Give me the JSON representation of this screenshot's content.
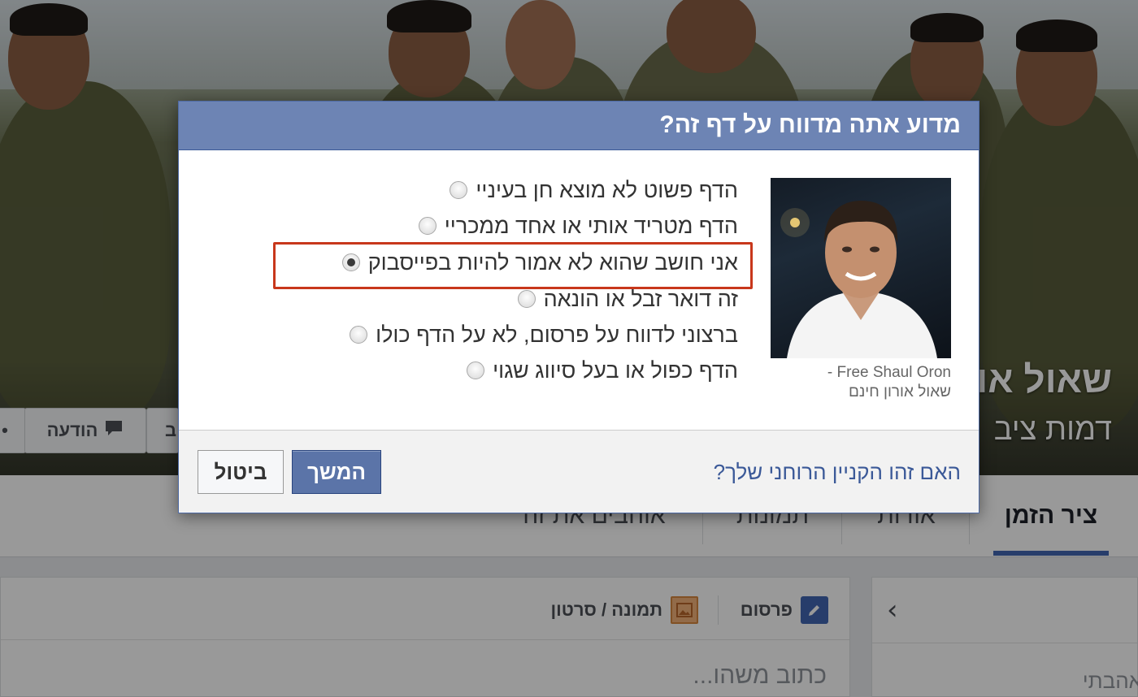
{
  "background": {
    "cover_name": "שאול או",
    "cover_category": "דמות ציב",
    "cover_buttons": {
      "message_label": "הודעה",
      "partial_label": "ב"
    },
    "nav_tabs": [
      {
        "label": "ציר הזמן",
        "active": true
      },
      {
        "label": "אודות",
        "active": false
      },
      {
        "label": "תמונות",
        "active": false
      },
      {
        "label": "אוהבים את זה",
        "active": false
      }
    ],
    "composer": {
      "post_tab": "פרסום",
      "photo_video_tab": "תמונה / סרטון",
      "placeholder": "כתוב משהו..."
    },
    "side_card": {
      "text": "אהבתי"
    }
  },
  "dialog": {
    "title": "מדוע אתה מדווח על דף זה?",
    "page_caption_en": "- Free Shaul Oron",
    "page_caption_he": "שאול אורון חינם",
    "options": [
      {
        "label": "הדף פשוט לא מוצא חן בעיניי",
        "checked": false
      },
      {
        "label": "הדף מטריד אותי או אחד ממכריי",
        "checked": false
      },
      {
        "label": "אני חושב שהוא לא אמור להיות בפייסבוק",
        "checked": true
      },
      {
        "label": "זה דואר זבל או הונאה",
        "checked": false
      },
      {
        "label": "ברצוני לדווח על פרסום, לא על הדף כולו",
        "checked": false
      },
      {
        "label": "הדף כפול או בעל סיווג שגוי",
        "checked": false
      }
    ],
    "footer_link": "האם זהו הקניין הרוחני שלך?",
    "continue_label": "המשך",
    "cancel_label": "ביטול"
  },
  "colors": {
    "header_blue": "#6d84b4",
    "link_blue": "#3b5998",
    "highlight_red": "#c8371b",
    "active_tab_underline": "#4267b2"
  }
}
